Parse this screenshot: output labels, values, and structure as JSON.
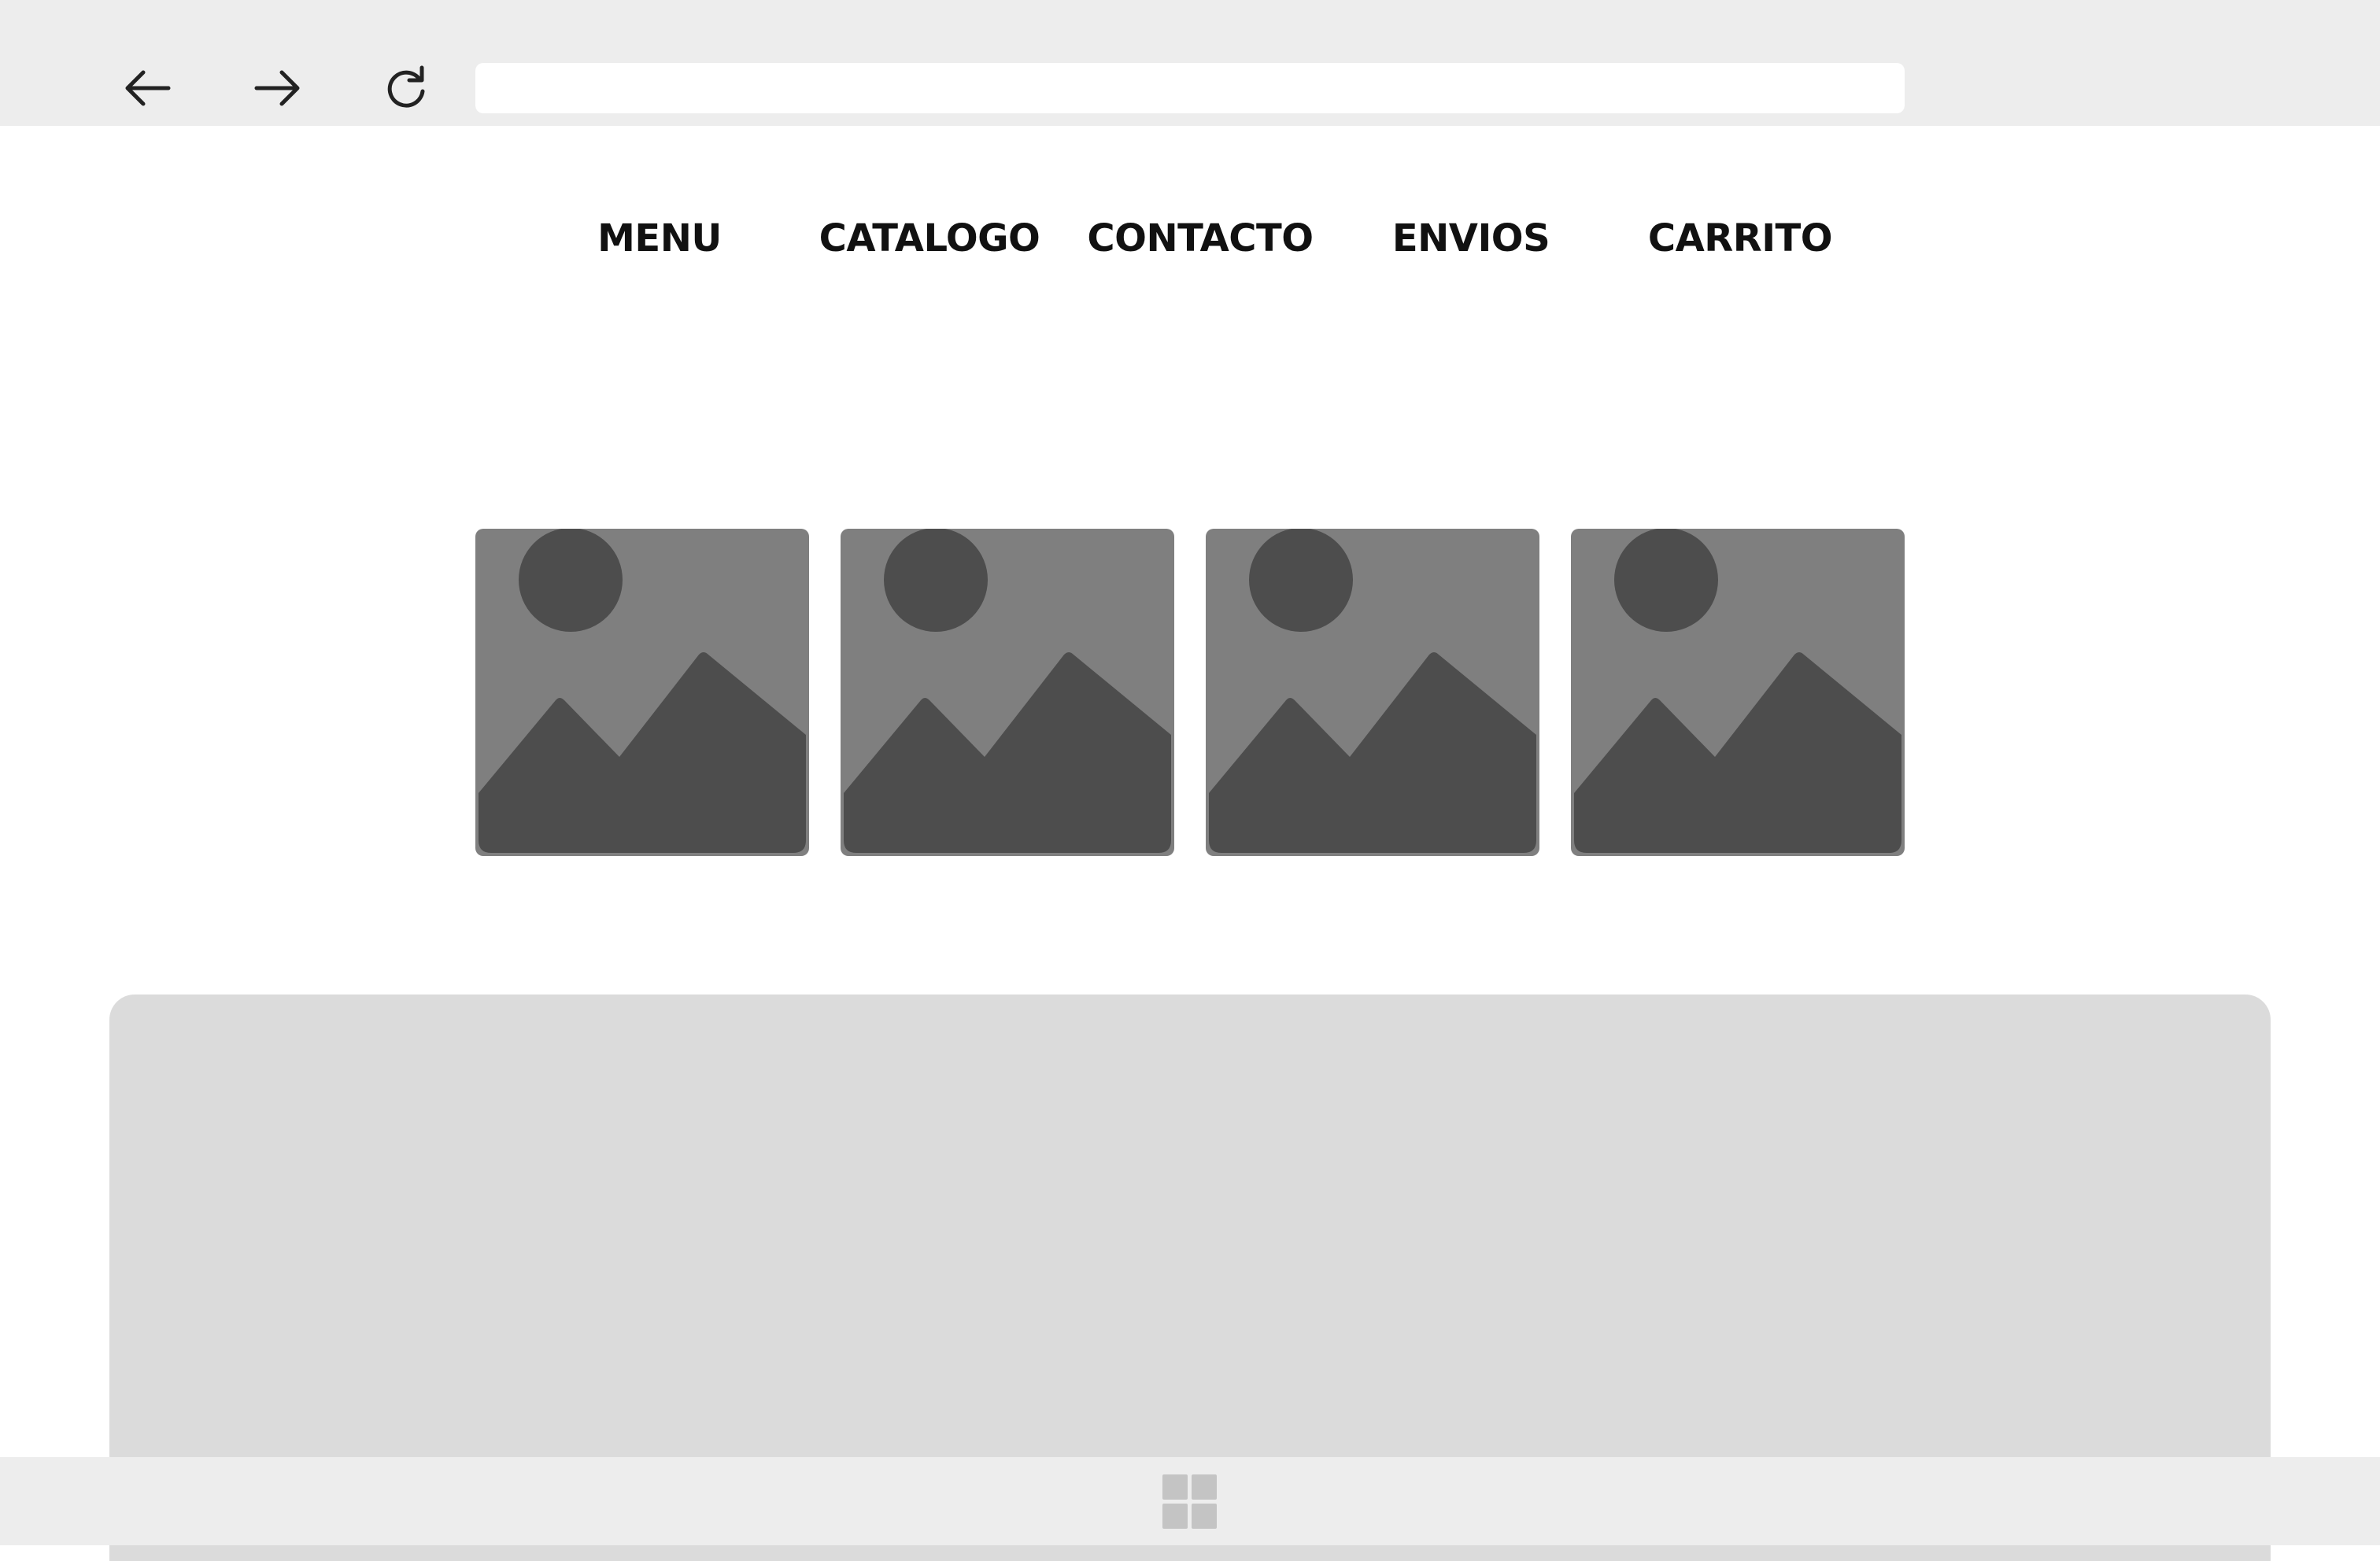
{
  "browser": {
    "back_icon": "arrow-left-icon",
    "forward_icon": "arrow-right-icon",
    "reload_icon": "reload-icon",
    "address_value": ""
  },
  "site_nav": {
    "items": [
      {
        "label": "MENU"
      },
      {
        "label": "CATALOGO"
      },
      {
        "label": "CONTACTO"
      },
      {
        "label": "ENVIOS"
      },
      {
        "label": "CARRITO"
      }
    ]
  },
  "gallery": {
    "image_icon": "image-placeholder-icon",
    "count": 4
  },
  "taskbar": {
    "start_icon": "windows-start-icon"
  },
  "colors": {
    "chrome_bg": "#ededed",
    "placeholder_bg": "#7f7f7f",
    "placeholder_fg": "#4d4d4d",
    "panel_bg": "#dbdbdb"
  }
}
